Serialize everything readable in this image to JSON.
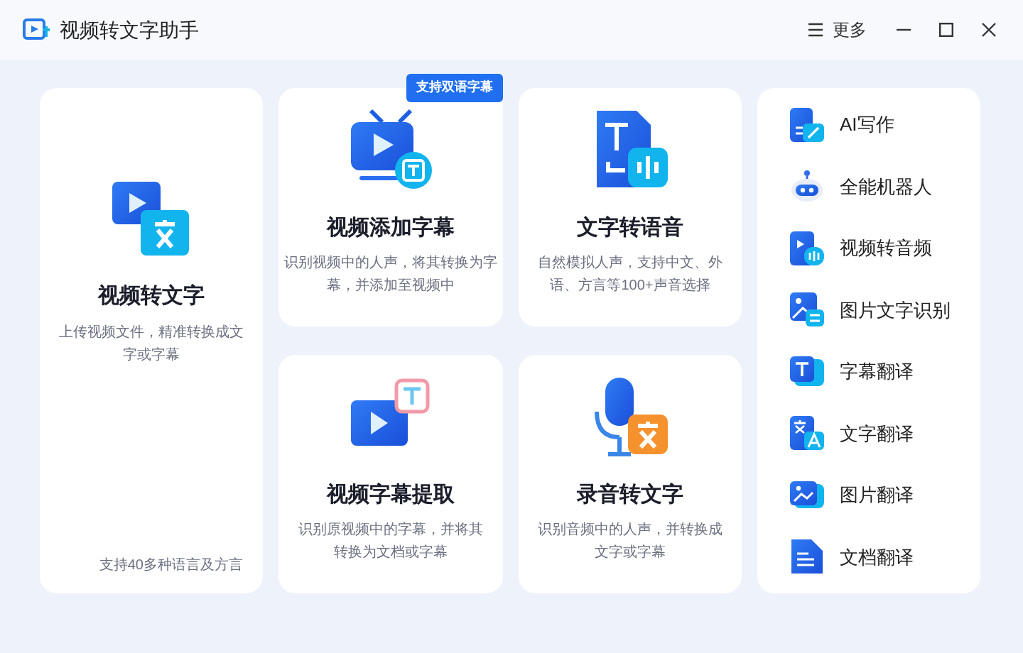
{
  "window": {
    "title": "视频转文字助手",
    "menu_label": "更多"
  },
  "feature_cards": [
    {
      "kind": "video-text",
      "title": "视频转文字",
      "description": "上传视频文件，精准转换成文字或字幕",
      "footnote": "支持40多种语言及方言"
    },
    {
      "kind": "tv",
      "title": "视频添加字幕",
      "description": "识别视频中的人声，将其转换为字幕，并添加至视频中",
      "badge": "支持双语字幕"
    },
    {
      "kind": "text-voice",
      "title": "文字转语音",
      "description": "自然模拟人声，支持中文、外语、方言等100+声音选择"
    },
    {
      "kind": "subtitle-extract",
      "title": "视频字幕提取",
      "description": "识别原视频中的字幕，并将其转换为文档或字幕"
    },
    {
      "kind": "mic",
      "title": "录音转文字",
      "description": "识别音频中的人声，并转换成文字或字幕"
    }
  ],
  "tools": [
    {
      "kind": "write",
      "label": "AI写作"
    },
    {
      "kind": "robot",
      "label": "全能机器人"
    },
    {
      "kind": "video-audio",
      "label": "视频转音频"
    },
    {
      "kind": "image-text",
      "label": "图片文字识别"
    },
    {
      "kind": "subtitle",
      "label": "字幕翻译"
    },
    {
      "kind": "translate",
      "label": "文字翻译"
    },
    {
      "kind": "image",
      "label": "图片翻译"
    },
    {
      "kind": "doc",
      "label": "文档翻译"
    }
  ]
}
